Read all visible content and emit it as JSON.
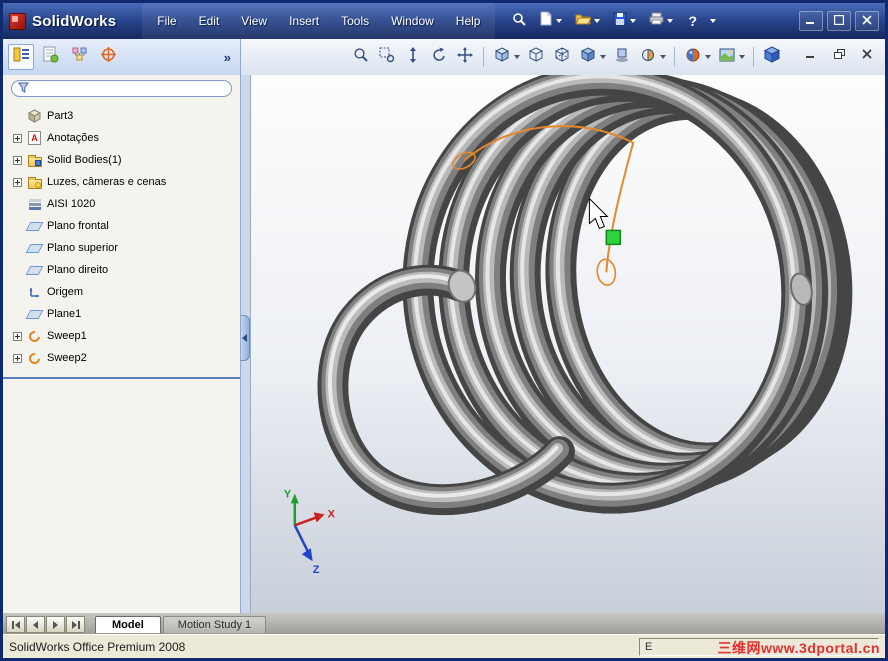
{
  "titlebar": {
    "app_title": "SolidWorks",
    "menus": [
      "File",
      "Edit",
      "View",
      "Insert",
      "Tools",
      "Window",
      "Help"
    ],
    "help_glyph": "?",
    "toolbar_icons": [
      "search",
      "new-document",
      "open",
      "save",
      "print"
    ],
    "window_controls": [
      "minimize",
      "maximize",
      "close"
    ]
  },
  "panel": {
    "overflow_chevron": "»",
    "filter_value": "",
    "tab_icons": [
      "featuremanager",
      "propertymanager",
      "configurationmanager",
      "dimxpertmanager"
    ],
    "icon_glyphs": {
      "annotation_letter": "A"
    },
    "tree": {
      "root_label": "Part3",
      "items": [
        {
          "label": "Anotações",
          "icon": "annotations-folder",
          "expandable": true
        },
        {
          "label": "Solid Bodies(1)",
          "icon": "solid-bodies-folder",
          "expandable": true
        },
        {
          "label": "Luzes, câmeras e cenas",
          "icon": "lights-cameras-folder",
          "expandable": true
        },
        {
          "label": "AISI 1020",
          "icon": "material",
          "expandable": false
        },
        {
          "label": "Plano frontal",
          "icon": "plane",
          "expandable": false
        },
        {
          "label": "Plano superior",
          "icon": "plane",
          "expandable": false
        },
        {
          "label": "Plano direito",
          "icon": "plane",
          "expandable": false
        },
        {
          "label": "Origem",
          "icon": "origin",
          "expandable": false
        },
        {
          "label": "Plane1",
          "icon": "plane",
          "expandable": false
        },
        {
          "label": "Sweep1",
          "icon": "sweep",
          "expandable": true
        },
        {
          "label": "Sweep2",
          "icon": "sweep",
          "expandable": true
        }
      ]
    }
  },
  "view_toolbar_icons": [
    "zoom-to-fit",
    "zoom-to-area",
    "zoom-in-out",
    "rotate-view",
    "pan",
    "standard-views",
    "wireframe",
    "hidden-lines-visible",
    "shaded-with-edges",
    "shadows",
    "section-view",
    "appearance",
    "apply-scene",
    "view-cube"
  ],
  "viewport": {
    "model": "helical-spring-sweep",
    "triad": {
      "x_label": "X",
      "y_label": "Y",
      "z_label": "Z"
    }
  },
  "bottom_tabs": {
    "model": "Model",
    "motion_study": "Motion Study 1"
  },
  "statusbar": {
    "left_text": "SolidWorks Office Premium 2008",
    "right_text": "E",
    "watermark": "三维网www.3dportal.cn"
  }
}
